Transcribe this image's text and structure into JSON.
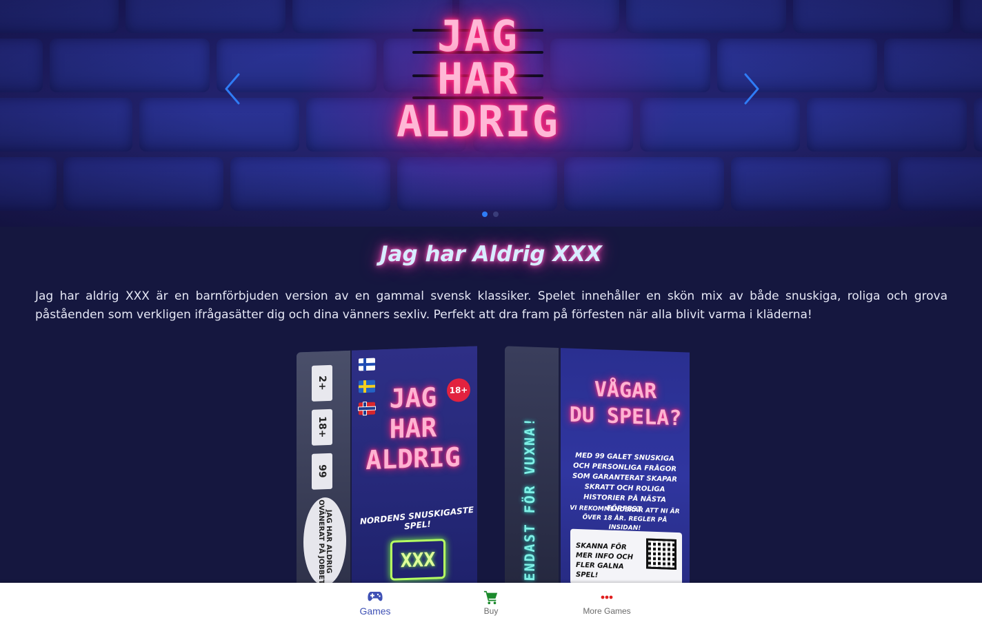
{
  "hero": {
    "logo_lines": [
      "JAG",
      "HAR",
      "ALDRIG"
    ],
    "prev_icon": "chevron-left-icon",
    "next_icon": "chevron-right-icon",
    "slide_count": 2,
    "active_slide": 1,
    "accent_color": "#2f7cf6"
  },
  "game": {
    "title": "Jag har Aldrig XXX",
    "description": "Jag har aldrig XXX är en barnförbjuden version av en gammal svensk klassiker. Spelet innehåller en skön mix av både snuskiga, roliga och grova påståenden som verkligen ifrågasätter dig och dina vänners sexliv. Perfekt att dra fram på förfesten när alla blivit varma i kläderna!"
  },
  "product": {
    "front_side_labels": [
      "2+",
      "18+",
      "99"
    ],
    "front_oval_text": "JAG HAR ALDRIG OVÄNERAT PÅ JOBBET",
    "front_age_badge": "18+",
    "front_logo_lines": [
      "JAG",
      "HAR",
      "ALDRIG"
    ],
    "front_tagline": "NORDENS SNUSKIGASTE SPEL!",
    "front_xxx": "XXX",
    "back_spine_text": "ENDAST FÖR VUXNA!",
    "back_logo_lines": [
      "VÅGAR",
      "DU SPELA?"
    ],
    "back_text": "MED 99 GALET SNUSKIGA OCH PERSONLIGA FRÅGOR SOM GARANTERAT SKAPAR SKRATT OCH ROLIGA HISTORIER PÅ NÄSTA FÖRFEST.",
    "back_text2": "VI REKOMMENDERAR ATT NI ÄR ÖVER 18 ÅR. REGLER PÅ INSIDAN!",
    "back_card_text": "SKANNA FÖR MER INFO OCH FLER GALNA SPEL!"
  },
  "bottom_nav": {
    "items": [
      {
        "label": "Games",
        "icon": "gamepad-icon",
        "color": "#3f51b5",
        "active": true
      },
      {
        "label": "Buy",
        "icon": "cart-icon",
        "color": "#1b8a2c",
        "active": false
      },
      {
        "label": "More Games",
        "icon": "more-dots-icon",
        "color": "#e02020",
        "active": false
      }
    ]
  }
}
